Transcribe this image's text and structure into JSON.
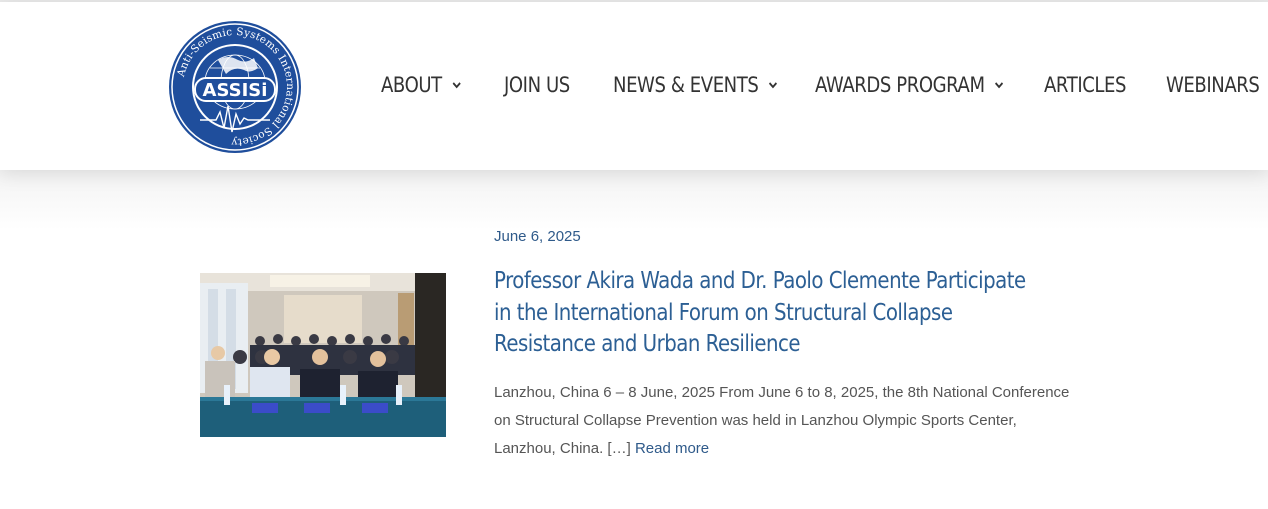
{
  "header": {
    "logo": {
      "text": "ASSISi",
      "ring_text": "Anti-Seismic Systems International Society",
      "icon": "globe-seismograph-emblem"
    },
    "nav": [
      {
        "label": "ABOUT",
        "has_dropdown": true
      },
      {
        "label": "JOIN US",
        "has_dropdown": false
      },
      {
        "label": "NEWS & EVENTS",
        "has_dropdown": true
      },
      {
        "label": "AWARDS PROGRAM",
        "has_dropdown": true
      },
      {
        "label": "ARTICLES",
        "has_dropdown": false
      },
      {
        "label": "WEBINARS",
        "has_dropdown": false
      }
    ]
  },
  "post": {
    "date": "June 6, 2025",
    "title": "Professor Akira Wada and Dr. Paolo Clemente Participate in the International Forum on Structural Collapse Resistance and Urban Resilience",
    "excerpt": "Lanzhou, China 6 – 8 June, 2025 From June 6 to 8, 2025, the 8th National Conference on Structural Collapse Prevention was held in Lanzhou Olympic Sports Center, Lanzhou, China. […]",
    "read_more": "Read more"
  },
  "colors": {
    "logo_blue": "#1f4e9c",
    "title_blue": "#2c5f94",
    "link_blue": "#2f5a8a",
    "nav_text": "#333333",
    "body_text": "#555555"
  }
}
